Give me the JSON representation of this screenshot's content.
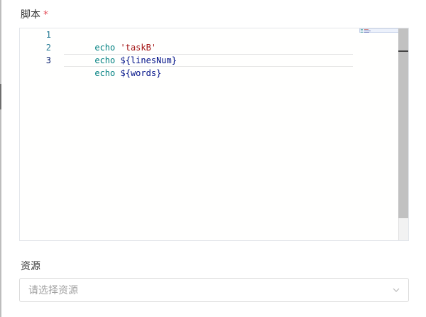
{
  "script_field": {
    "label": "脚本",
    "required_mark": "*",
    "code_lines": [
      {
        "number": "1",
        "keyword": "echo",
        "arg": "'taskB'",
        "arg_kind": "string"
      },
      {
        "number": "2",
        "keyword": "echo",
        "arg": "${linesNum}",
        "arg_kind": "var"
      },
      {
        "number": "3",
        "keyword": "echo",
        "arg": "${words}",
        "arg_kind": "var"
      }
    ],
    "active_line": 3
  },
  "resource_field": {
    "label": "资源",
    "placeholder": "请选择资源"
  },
  "colors": {
    "keyword": "#008080",
    "string": "#a31515",
    "variable": "#001188",
    "line_number": "#237893",
    "required": "#e34d59"
  },
  "icons": {
    "dropdown": "chevron-down-icon"
  }
}
